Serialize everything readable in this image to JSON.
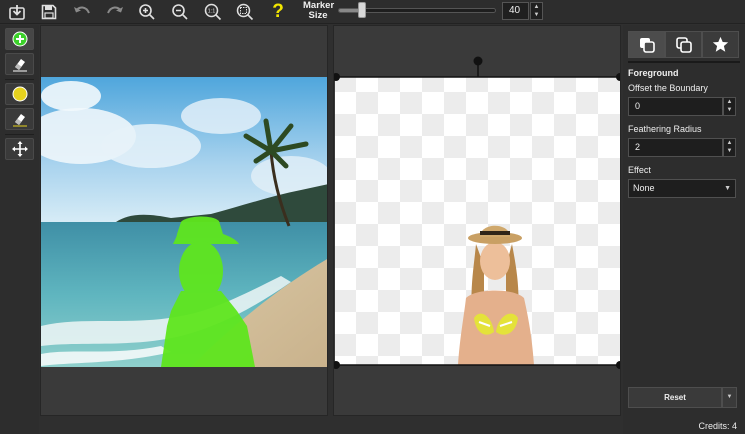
{
  "toolbar": {
    "buttons": [
      {
        "name": "import-icon"
      },
      {
        "name": "save-icon"
      },
      {
        "name": "undo-icon"
      },
      {
        "name": "redo-icon"
      },
      {
        "name": "zoom-in-icon"
      },
      {
        "name": "zoom-out-icon"
      },
      {
        "name": "actual-size-icon",
        "text": "1:1"
      },
      {
        "name": "fit-to-window-icon"
      },
      {
        "name": "help-icon",
        "text": "?"
      }
    ],
    "marker_label": "Marker\nSize",
    "marker_size": "40",
    "marker_fraction": 0.15
  },
  "tools": [
    {
      "name": "keep-marker-tool",
      "icon": "plus-circle-icon",
      "color": "#3cd12a"
    },
    {
      "name": "keep-eraser-tool",
      "icon": "eraser-icon"
    },
    {
      "name": "remove-marker-tool",
      "icon": "circle-icon",
      "color": "#e6d21e"
    },
    {
      "name": "remove-eraser-tool",
      "icon": "eraser-icon"
    },
    {
      "name": "move-tool",
      "icon": "move-icon"
    }
  ],
  "panel": {
    "tabs": [
      {
        "name": "foreground-tab",
        "icon": "layers-icon"
      },
      {
        "name": "background-tab",
        "icon": "layers-outline-icon"
      },
      {
        "name": "favorites-tab",
        "icon": "star-icon"
      }
    ],
    "section_title": "Foreground",
    "offset_label": "Offset the Boundary",
    "offset_value": "0",
    "feather_label": "Feathering Radius",
    "feather_value": "2",
    "effect_label": "Effect",
    "effect_value": "None",
    "reset_label": "Reset",
    "credits": "Credits: 4"
  },
  "colors": {
    "keep_mask": "#5fe61e",
    "remove_marker": "#e6d21e",
    "bikini": "#e4e23a"
  }
}
